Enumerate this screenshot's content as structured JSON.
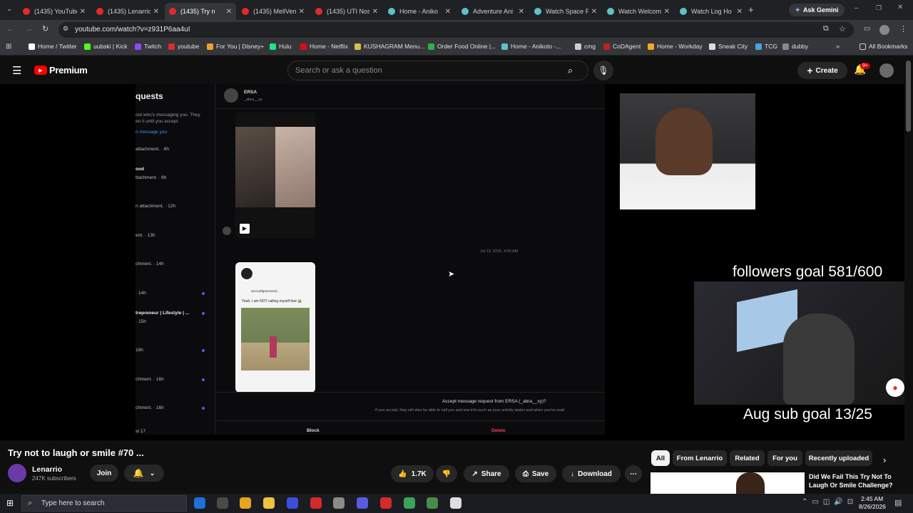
{
  "tabs": [
    {
      "label": "(1435) YouTube",
      "fav": "#e02b2b"
    },
    {
      "label": "(1435) Lenarrio",
      "fav": "#e02b2b"
    },
    {
      "label": "(1435) Try n",
      "fav": "#e02b2b"
    },
    {
      "label": "(1435) MellVen",
      "fav": "#e02b2b"
    },
    {
      "label": "(1435) UTI Nos",
      "fav": "#e02b2b"
    },
    {
      "label": "Home - Aniko",
      "fav": "#5dc2c9"
    },
    {
      "label": "Adventure Ani",
      "fav": "#5dc2c9"
    },
    {
      "label": "Watch Space P",
      "fav": "#5dc2c9"
    },
    {
      "label": "Watch Welcom",
      "fav": "#5dc2c9"
    },
    {
      "label": "Watch Log Ho",
      "fav": "#5dc2c9"
    }
  ],
  "ask_gemini": "Ask Gemini",
  "url": "youtube.com/watch?v=z931P6aa4uI",
  "bookmarks": [
    {
      "label": "Home / Twitter",
      "color": "#fff"
    },
    {
      "label": "uubski | Kick",
      "color": "#53fc18"
    },
    {
      "label": "Twitch",
      "color": "#9146ff"
    },
    {
      "label": "youtube",
      "color": "#e02b2b"
    },
    {
      "label": "For You | Disney+",
      "color": "#f0a030"
    },
    {
      "label": "Hulu",
      "color": "#1ce783"
    },
    {
      "label": "Home - Netflix",
      "color": "#e50914"
    },
    {
      "label": "KUSHAGRAM Menu...",
      "color": "#d6c24a"
    },
    {
      "label": "Order Food Online |...",
      "color": "#2bb24c"
    },
    {
      "label": "Home - Anikoto -...",
      "color": "#5dc2c9"
    },
    {
      "label": "cmg",
      "color": "#ccc"
    },
    {
      "label": "CoDAgent",
      "color": "#b22"
    },
    {
      "label": "Home - Workday",
      "color": "#f5a623"
    },
    {
      "label": "Sneak City",
      "color": "#ddd"
    },
    {
      "label": "TCG",
      "color": "#4aa3df"
    },
    {
      "label": "dubby",
      "color": "#888"
    }
  ],
  "all_bookmarks": "All Bookmarks",
  "yt": {
    "brand": "Premium",
    "search_placeholder": "Search or ask a question",
    "create": "Create",
    "notif_count": "9+"
  },
  "dm": {
    "header": "quests",
    "subtext1": "out who's messaging you. They",
    "subtext2": "en it until you accept.",
    "link": "n message you",
    "items": [
      "attachment. · 6h",
      "ood",
      "ttachment. · 6h",
      "n attachment. · 12h",
      "ent. · 13h",
      "chment. · 14h",
      "· 14h",
      "trepreneur | Lifestyle | ...",
      "· 15h",
      "16h",
      "chment. · 16h",
      "chment. · 16h",
      "st 17"
    ],
    "user": "ERSA",
    "user_handle": "_abra__xy",
    "timestamp": "Jul 13, 2026, 4:50 AM",
    "card_name": "tacocatfgammeral...",
    "card_text": "Yeah, I am NOT calling myself that 😭",
    "accept_title": "Accept message request from ERSA (_abra__xy)?",
    "accept_sub": "If you accept, they will also be able to call you and see info such as your activity status and when you've read",
    "block": "Block",
    "delete": "Delete"
  },
  "overlay": {
    "followers_goal": "followers goal 581/600",
    "sub_goal": "Aug sub goal 13/25"
  },
  "video": {
    "title": "Try not to laugh or smile #70 ...",
    "channel": "Lenarrio",
    "subscribers": "247K subscribers",
    "join": "Join",
    "likes": "1.7K",
    "share": "Share",
    "save": "Save",
    "download": "Download"
  },
  "filters": [
    "All",
    "From Lenarrio",
    "Related",
    "For you",
    "Recently uploaded"
  ],
  "rec": {
    "title": "Did We Fail This Try Not To Laugh Or Smile Challenge?"
  },
  "taskbar": {
    "search": "Type here to search",
    "time": "2:45 AM",
    "date": "8/26/2026"
  }
}
